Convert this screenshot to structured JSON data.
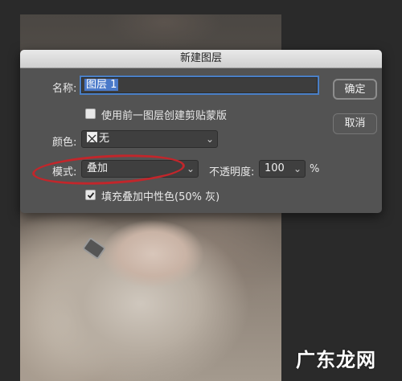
{
  "dialog": {
    "title": "新建图层",
    "name_label": "名称:",
    "name_value": "图层 1",
    "clip_checkbox_label": "使用前一图层创建剪贴蒙版",
    "clip_checked": false,
    "color_label": "颜色:",
    "color_value": "无",
    "mode_label": "模式:",
    "mode_value": "叠加",
    "opacity_label": "不透明度:",
    "opacity_value": "100",
    "opacity_unit": "%",
    "fill_checkbox_label": "填充叠加中性色(50% 灰)",
    "fill_checked": true,
    "ok_label": "确定",
    "cancel_label": "取消"
  },
  "annotation": {
    "color": "#c2262b"
  },
  "watermark": {
    "text": "广东龙网"
  },
  "colors": {
    "dialog_bg": "#535353",
    "accent": "#4a79c9"
  }
}
